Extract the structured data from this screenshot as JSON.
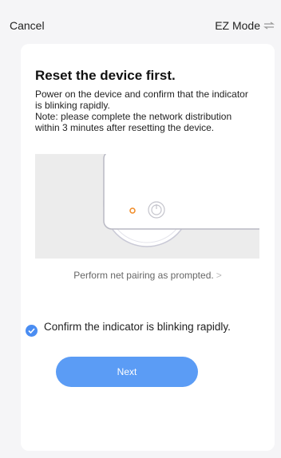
{
  "header": {
    "cancel_label": "Cancel",
    "mode_label": "EZ Mode",
    "mode_icon": "swap-icon"
  },
  "content": {
    "title": "Reset the device first.",
    "description_lines": [
      "Power on the device and confirm that the indicator is blinking rapidly.",
      "Note: please complete the network distribution within 3 minutes after resetting the device."
    ],
    "illustration": "device-reset-illustration",
    "pairing_link": "Perform net pairing as prompted.",
    "pairing_chevron": ">"
  },
  "confirm": {
    "label": "Confirm the indicator is blinking rapidly.",
    "checked": true
  },
  "actions": {
    "next_label": "Next"
  },
  "colors": {
    "accent": "#4a8df2",
    "button": "#5b9cf5",
    "indicator": "#f08a24",
    "background": "#f5f5f7"
  }
}
